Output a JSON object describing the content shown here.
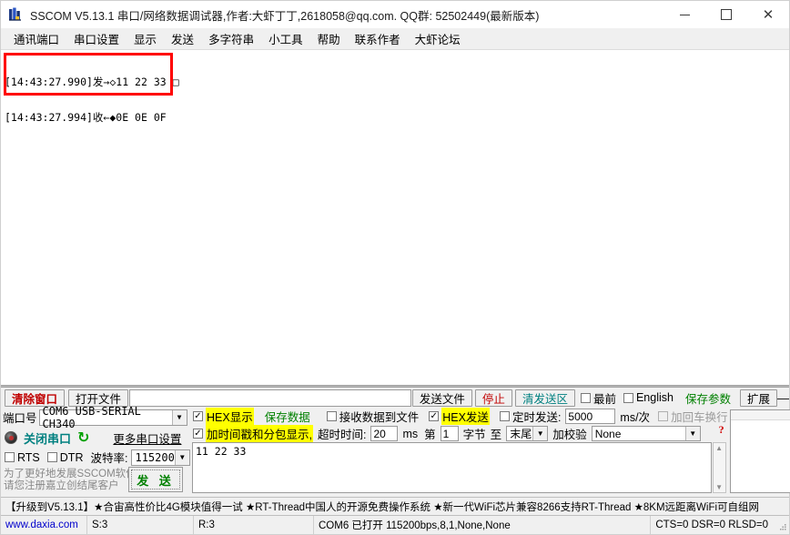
{
  "window": {
    "title": "SSCOM V5.13.1 串口/网络数据调试器,作者:大虾丁丁,2618058@qq.com. QQ群: 52502449(最新版本)",
    "icon": "app-icon",
    "minimize": "—",
    "maximize": "□",
    "close": "✕"
  },
  "menu": {
    "items": [
      {
        "label": "通讯端口"
      },
      {
        "label": "串口设置"
      },
      {
        "label": "显示"
      },
      {
        "label": "发送"
      },
      {
        "label": "多字符串"
      },
      {
        "label": "小工具"
      },
      {
        "label": "帮助"
      },
      {
        "label": "联系作者"
      },
      {
        "label": "大虾论坛"
      }
    ]
  },
  "receive": {
    "lines": [
      "[14:43:27.990]发→◇11 22 33 □",
      "[14:43:27.994]收←◆0E 0E 0F"
    ],
    "highlight_color": "#ff0000"
  },
  "toolbar": {
    "clear_window": "清除窗口",
    "open_file": "打开文件",
    "file_path": "",
    "send_file": "发送文件",
    "stop": "停止",
    "clear_send_area": "清发送区",
    "topmost_label": "最前",
    "topmost_checked": false,
    "english_label": "English",
    "english_checked": false,
    "save_params": "保存参数",
    "extend": "扩展",
    "collapse": "—"
  },
  "serial": {
    "port_label": "端口号",
    "port_value": "COM6 USB-SERIAL CH340",
    "close_port": "关闭串口",
    "refresh_icon": "refresh-icon",
    "more_settings": "更多串口设置",
    "rts_label": "RTS",
    "rts_checked": false,
    "dtr_label": "DTR",
    "dtr_checked": false,
    "baud_label": "波特率:",
    "baud_value": "115200",
    "promo_text": "为了更好地发展SSCOM软件\n请您注册嘉立创结尾客户",
    "send_button": "发 送"
  },
  "options": {
    "hex_display": "HEX显示",
    "hex_display_checked": true,
    "save_data": "保存数据",
    "recv_to_file": "接收数据到文件",
    "recv_to_file_checked": false,
    "hex_send": "HEX发送",
    "hex_send_checked": true,
    "timed_send": "定时发送:",
    "timed_send_checked": false,
    "timed_send_value": "5000",
    "timed_send_unit": "ms/次",
    "add_crlf": "加回车换行",
    "add_crlf_checked": false,
    "timestamp_pack": "加时间戳和分包显示,",
    "timestamp_pack_checked": true,
    "timeout_label": "超时时间:",
    "timeout_value": "20",
    "timeout_unit": "ms",
    "byte_from_label": "第",
    "byte_from_value": "1",
    "byte_label": "字节",
    "byte_to_label": "至",
    "byte_to_value": "末尾",
    "checksum_label": "加校验",
    "checksum_value": "None",
    "help_marker": "?"
  },
  "send_area": {
    "content": "11 22 33"
  },
  "ad": {
    "text": "【升级到V5.13.1】★合宙高性价比4G模块值得一试 ★RT-Thread中国人的开源免费操作系统 ★新一代WiFi芯片兼容8266支持RT-Thread ★8KM远距离WiFi可自组网"
  },
  "status": {
    "site": "www.daxia.com",
    "sent": "S:3",
    "received": "R:3",
    "port_state": "COM6 已打开  115200bps,8,1,None,None",
    "signals": "CTS=0 DSR=0 RLSD=0"
  }
}
